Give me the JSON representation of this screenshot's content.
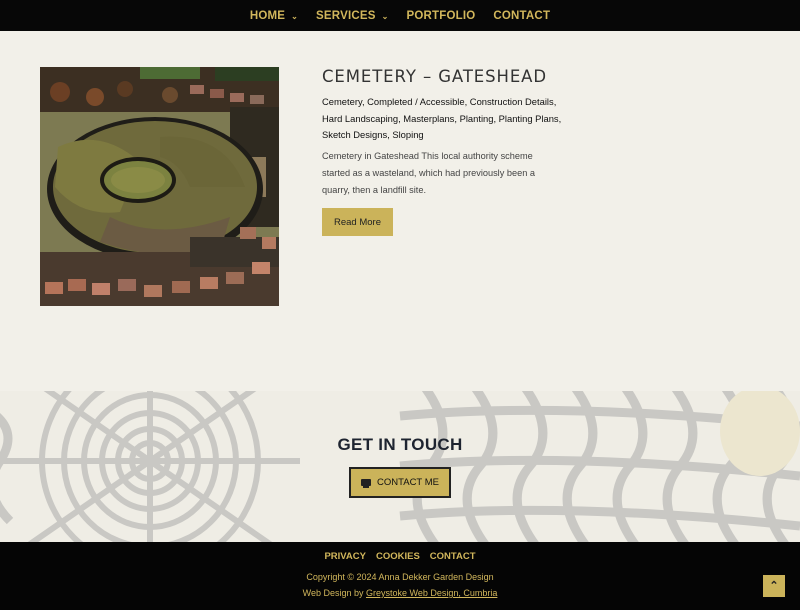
{
  "nav": {
    "items": [
      {
        "label": "HOME",
        "dropdown": true
      },
      {
        "label": "SERVICES",
        "dropdown": true
      },
      {
        "label": "PORTFOLIO",
        "dropdown": false
      },
      {
        "label": "CONTACT",
        "dropdown": false
      }
    ],
    "dropdown_glyph": "⌄"
  },
  "post": {
    "title": "CEMETERY – GATESHEAD",
    "categories": "Cemetery, Completed / Accessible, Construction Details, Hard Landscaping, Masterplans, Planting, Planting Plans, Sketch Designs, Sloping",
    "excerpt": "Cemetery in Gateshead This local authority scheme started as a wasteland, which had previously been a quarry, then a landfill site.",
    "read_more": "Read More",
    "thumbnail_icon": "aerial-photo"
  },
  "cta": {
    "title": "GET IN TOUCH",
    "button_label": "CONTACT ME",
    "button_icon": "truck-icon"
  },
  "footer": {
    "links": [
      "PRIVACY",
      "COOKIES",
      "CONTACT"
    ],
    "copyright": "Copyright © 2024 Anna Dekker Garden Design",
    "credit_prefix": "Web Design by ",
    "credit_link": "Greystoke Web Design, Cumbria",
    "scroll_top_glyph": "⌃"
  },
  "colors": {
    "accent": "#cbb35a",
    "nav_text": "#d2b75c",
    "background": "#f2f0e9",
    "dark": "#070707"
  }
}
